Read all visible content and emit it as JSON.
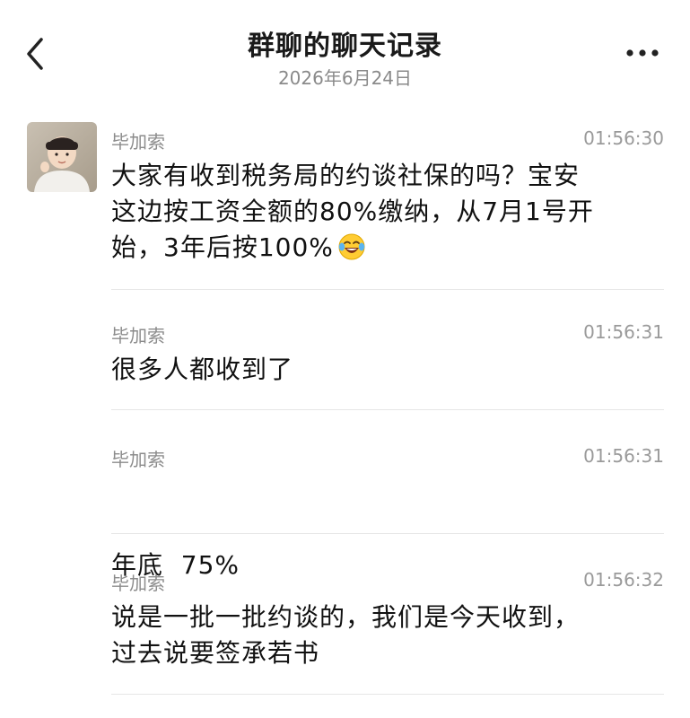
{
  "header": {
    "title": "群聊的聊天记录",
    "date": "2026年6月24日"
  },
  "messages": [
    {
      "sender": "毕加索",
      "time": "01:56:30",
      "lines": [
        "大家有收到税务局的约谈社保的吗？宝安",
        "这边按工资全额的80%缴纳，从7月1号开",
        "始，3年后按100%"
      ],
      "emoji": "tears-of-joy-emoji"
    },
    {
      "sender": "毕加索",
      "time": "01:56:31",
      "lines": [
        "很多人都收到了"
      ]
    },
    {
      "sender": "毕加索",
      "time": "01:56:31",
      "lines": [
        "年底  75%"
      ]
    },
    {
      "sender": "毕加索",
      "time": "01:56:32",
      "lines": [
        "说是一批一批约谈的，我们是今天收到，",
        "过去说要签承若书"
      ]
    }
  ],
  "icons": {
    "back": "chevron-left-icon",
    "more": "more-dots-icon",
    "avatar": "avatar"
  },
  "colors": {
    "background": "#ffffff",
    "text": "#111111",
    "meta": "#8c8c8c",
    "divider": "#e6e6e6"
  }
}
